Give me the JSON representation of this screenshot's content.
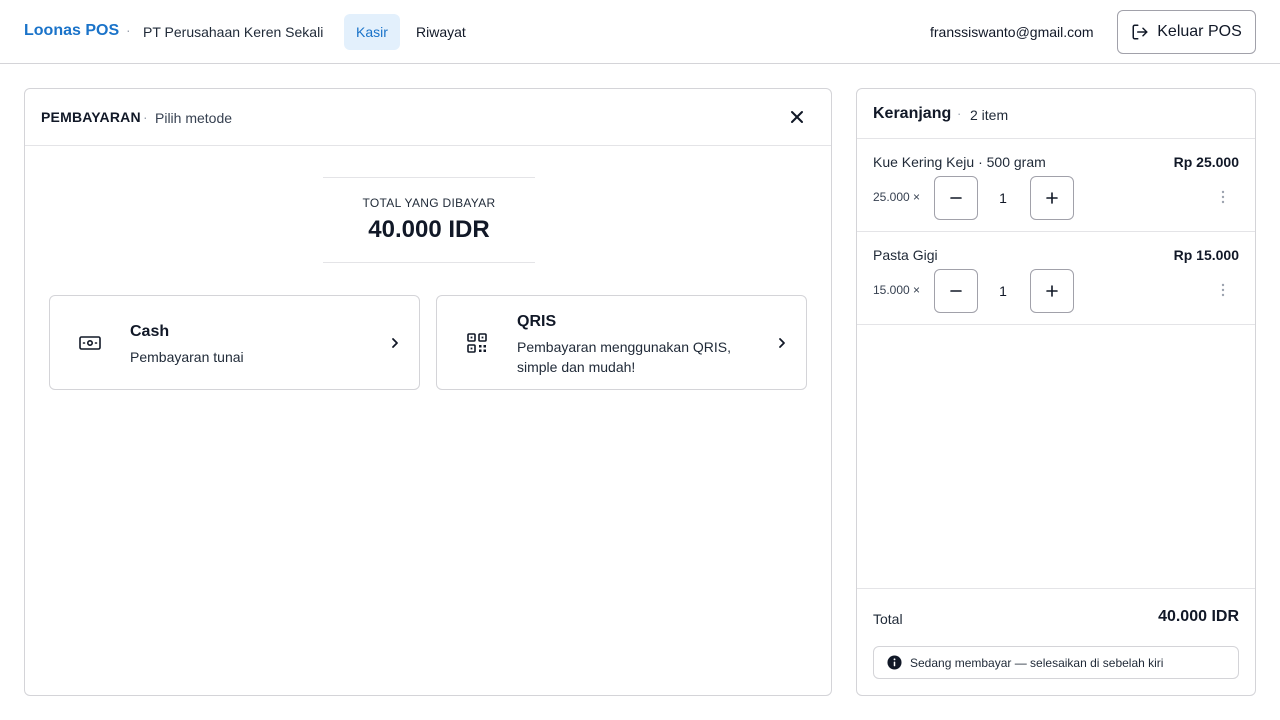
{
  "header": {
    "brand": "Loonas POS",
    "separator": "·",
    "company": "PT Perusahaan Keren Sekali",
    "tabs": [
      {
        "label": "Kasir",
        "active": true
      },
      {
        "label": "Riwayat",
        "active": false
      }
    ],
    "user_email": "franssiswanto@gmail.com",
    "logout_label": "Keluar POS"
  },
  "payment": {
    "title": "PEMBAYARAN",
    "separator": "·",
    "subtitle": "Pilih metode",
    "total_label": "TOTAL YANG DIBAYAR",
    "total_value": "40.000 IDR",
    "methods": [
      {
        "title": "Cash",
        "description": "Pembayaran tunai",
        "icon": "banknote-icon"
      },
      {
        "title": "QRIS",
        "description": "Pembayaran menggunakan QRIS, simple dan mudah!",
        "icon": "qr-code-icon"
      }
    ]
  },
  "cart": {
    "title": "Keranjang",
    "separator": "·",
    "count_label": "2 item",
    "items": [
      {
        "name": "Kue Kering Keju · 500 gram",
        "price": "Rp 25.000",
        "unit": "25.000 ×",
        "qty": "1"
      },
      {
        "name": "Pasta Gigi",
        "price": "Rp 15.000",
        "unit": "15.000 ×",
        "qty": "1"
      }
    ],
    "total_label": "Total",
    "total_value": "40.000 IDR",
    "status": "Sedang membayar — selesaikan di sebelah kiri"
  },
  "colors": {
    "accent": "#1a73c9",
    "accent_bg": "#e3f0fc",
    "border": "#d4d4d8"
  }
}
